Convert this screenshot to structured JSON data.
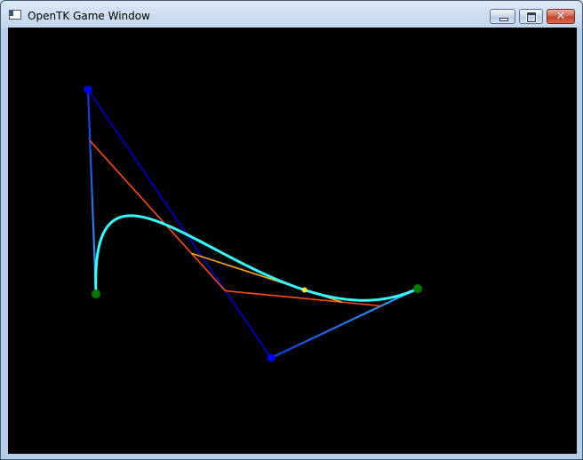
{
  "window": {
    "title": "OpenTK Game Window",
    "icon": "opentk-app-icon",
    "controls": {
      "minimize_icon": "minimize-icon",
      "maximize_icon": "maximize-icon",
      "close_symbol": "✕",
      "close_color": "#c1432c"
    }
  },
  "scene": {
    "background": "#000000",
    "colors": {
      "control_polygon_start": "#1e90ff",
      "control_polygon_end": "#0000b0",
      "curve": "#33ffff",
      "level1": "#ff4a10",
      "level2": "#ffaa00",
      "point_on_curve": "#ffe040",
      "endpoint": "#007a00",
      "control_point": "#0000ff"
    },
    "parameter_t": 0.75
  }
}
